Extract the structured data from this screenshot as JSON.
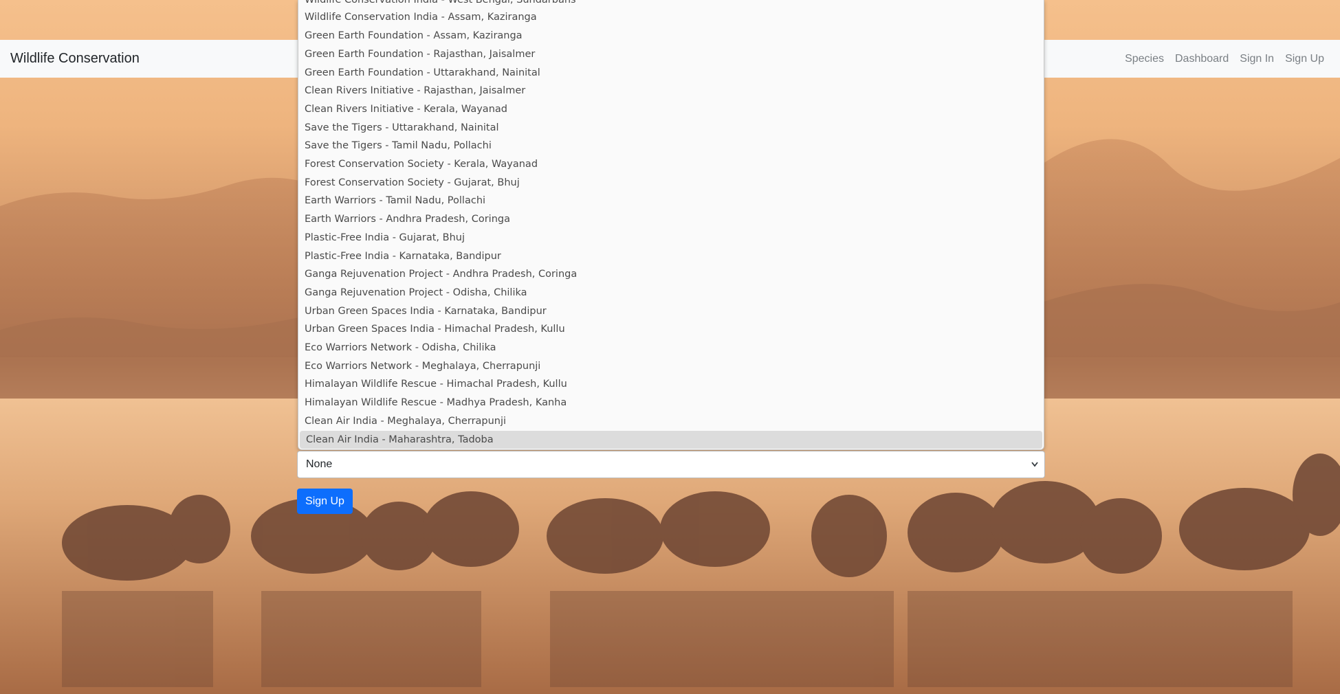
{
  "navbar": {
    "brand": "Wildlife Conservation",
    "links": [
      "Species",
      "Dashboard",
      "Sign In",
      "Sign Up"
    ]
  },
  "dropdown": {
    "partial_top_item": "Wildlife Conservation India - West Bengal, Sundarbans",
    "items": [
      "Wildlife Conservation India - Assam, Kaziranga",
      "Green Earth Foundation - Assam, Kaziranga",
      "Green Earth Foundation - Rajasthan, Jaisalmer",
      "Green Earth Foundation - Uttarakhand, Nainital",
      "Clean Rivers Initiative - Rajasthan, Jaisalmer",
      "Clean Rivers Initiative - Kerala, Wayanad",
      "Save the Tigers - Uttarakhand, Nainital",
      "Save the Tigers - Tamil Nadu, Pollachi",
      "Forest Conservation Society - Kerala, Wayanad",
      "Forest Conservation Society - Gujarat, Bhuj",
      "Earth Warriors - Tamil Nadu, Pollachi",
      "Earth Warriors - Andhra Pradesh, Coringa",
      "Plastic-Free India - Gujarat, Bhuj",
      "Plastic-Free India - Karnataka, Bandipur",
      "Ganga Rejuvenation Project - Andhra Pradesh, Coringa",
      "Ganga Rejuvenation Project - Odisha, Chilika",
      "Urban Green Spaces India - Karnataka, Bandipur",
      "Urban Green Spaces India - Himachal Pradesh, Kullu",
      "Eco Warriors Network - Odisha, Chilika",
      "Eco Warriors Network - Meghalaya, Cherrapunji",
      "Himalayan Wildlife Rescue - Himachal Pradesh, Kullu",
      "Himalayan Wildlife Rescue - Madhya Pradesh, Kanha",
      "Clean Air India - Meghalaya, Cherrapunji",
      "Clean Air India - Maharashtra, Tadoba"
    ],
    "highlighted_index": 23
  },
  "select": {
    "value": "None",
    "icon": "chevron-down-icon"
  },
  "submit": {
    "label": "Sign Up",
    "color": "#0d6efd"
  },
  "background": {
    "subject": "pelicans-at-sunset"
  }
}
